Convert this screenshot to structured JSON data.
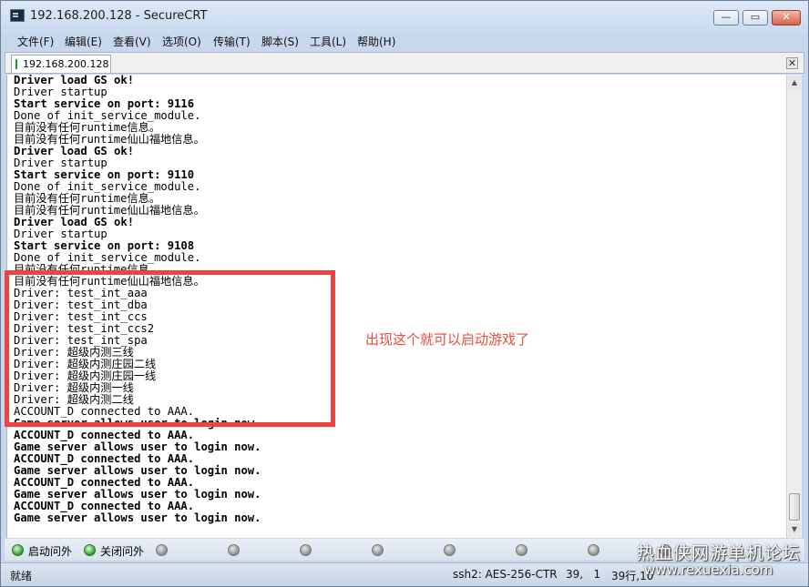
{
  "window": {
    "title": "192.168.200.128 - SecureCRT",
    "controls": {
      "minimize": "—",
      "maximize": "▭",
      "close": "✕"
    }
  },
  "menu": [
    "文件(F)",
    "编辑(E)",
    "查看(V)",
    "选项(O)",
    "传输(T)",
    "脚本(S)",
    "工具(L)",
    "帮助(H)"
  ],
  "tab": {
    "label": "192.168.200.128",
    "close": "✕"
  },
  "terminal": {
    "lines": [
      {
        "text": "Driver load GS ok!",
        "bold": true
      },
      {
        "text": "Driver startup",
        "bold": false
      },
      {
        "text": "Start service on port: 9116",
        "bold": true
      },
      {
        "text": "Done of init_service_module.",
        "bold": false
      },
      {
        "text": "目前没有任何runtime信息。",
        "bold": false
      },
      {
        "text": "目前没有任何runtime仙山福地信息。",
        "bold": false
      },
      {
        "text": "Driver load GS ok!",
        "bold": true
      },
      {
        "text": "Driver startup",
        "bold": false
      },
      {
        "text": "Start service on port: 9110",
        "bold": true
      },
      {
        "text": "Done of init_service_module.",
        "bold": false
      },
      {
        "text": "目前没有任何runtime信息。",
        "bold": false
      },
      {
        "text": "目前没有任何runtime仙山福地信息。",
        "bold": false
      },
      {
        "text": "Driver load GS ok!",
        "bold": true
      },
      {
        "text": "Driver startup",
        "bold": false
      },
      {
        "text": "Start service on port: 9108",
        "bold": true
      },
      {
        "text": "Done of init_service_module.",
        "bold": false
      },
      {
        "text": "目前没有任何runtime信息。",
        "bold": false
      },
      {
        "text": "目前没有任何runtime仙山福地信息。",
        "bold": false
      },
      {
        "text": "Driver: test_int_aaa",
        "bold": false
      },
      {
        "text": "Driver: test_int_dba",
        "bold": false
      },
      {
        "text": "Driver: test_int_ccs",
        "bold": false
      },
      {
        "text": "Driver: test_int_ccs2",
        "bold": false
      },
      {
        "text": "Driver: test_int_spa",
        "bold": false
      },
      {
        "text": "Driver: 超级内测三线",
        "bold": false
      },
      {
        "text": "Driver: 超级内测庄园二线",
        "bold": false
      },
      {
        "text": "Driver: 超级内测庄园一线",
        "bold": false
      },
      {
        "text": "Driver: 超级内测一线",
        "bold": false
      },
      {
        "text": "Driver: 超级内测二线",
        "bold": false
      },
      {
        "text": "ACCOUNT_D connected to AAA.",
        "bold": false
      },
      {
        "text": "Game server allows user to login now.",
        "bold": true
      },
      {
        "text": "ACCOUNT_D connected to AAA.",
        "bold": true
      },
      {
        "text": "Game server allows user to login now.",
        "bold": true
      },
      {
        "text": "ACCOUNT_D connected to AAA.",
        "bold": true
      },
      {
        "text": "Game server allows user to login now.",
        "bold": true
      },
      {
        "text": "ACCOUNT_D connected to AAA.",
        "bold": true
      },
      {
        "text": "Game server allows user to login now.",
        "bold": true
      },
      {
        "text": "ACCOUNT_D connected to AAA.",
        "bold": true
      },
      {
        "text": "Game server allows user to login now.",
        "bold": true
      }
    ]
  },
  "annotation": {
    "text": "出现这个就可以启动游戏了",
    "color": "#e84c3c",
    "box_color": "#f24141"
  },
  "button_bar": {
    "buttons": [
      {
        "label": "启动问外",
        "icon": "green-dot-icon"
      },
      {
        "label": "关闭问外",
        "icon": "green-dot-icon"
      }
    ],
    "empty_slots": 8
  },
  "status": {
    "ready": "就绪",
    "cipher": "ssh2: AES-256-CTR",
    "position": "39,   1",
    "size": "39行,10"
  },
  "watermark": {
    "line1": "热血侠网游单机论坛",
    "line2": "www.rexuexia.com"
  }
}
